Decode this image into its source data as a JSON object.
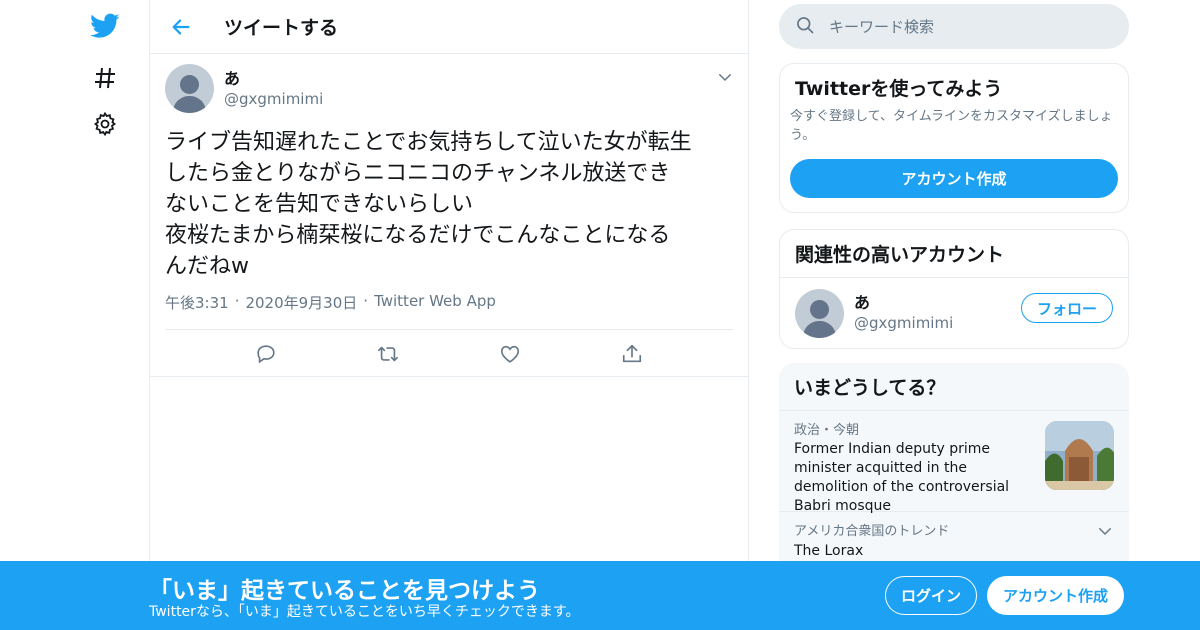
{
  "colors": {
    "accent": "#1da1f2",
    "text": "#14171a",
    "muted": "#657786",
    "border": "#e6ecf0"
  },
  "leftnav": {
    "icons": [
      "twitter-logo-icon",
      "hashtag-icon",
      "gear-icon"
    ]
  },
  "header": {
    "title": "ツイートする"
  },
  "tweet": {
    "author_name": "あ",
    "author_handle": "@gxgmimimi",
    "text": "ライブ告知遅れたことでお気持ちして泣いた女が転生\nしたら金とりながらニコニコのチャンネル放送でき\nないことを告知できないらしい\n夜桜たまから楠栞桜になるだけでこんなことになる\nんだねw",
    "time": "午後3:31",
    "date": "2020年9月30日",
    "source": "Twitter Web App",
    "separator": "·"
  },
  "search": {
    "placeholder": "キーワード検索"
  },
  "signup_card": {
    "title": "Twitterを使ってみよう",
    "description": "今すぐ登録して、タイムラインをカスタマイズしましょう。",
    "button": "アカウント作成"
  },
  "relevant_card": {
    "title": "関連性の高いアカウント",
    "account_name": "あ",
    "account_handle": "@gxgmimimi",
    "follow_button": "フォロー"
  },
  "trends_card": {
    "title": "いまどうしてる？",
    "items": [
      {
        "context": "政治・今朝",
        "headline": "Former Indian deputy prime minister acquitted in the demolition of the controversial Babri mosque"
      },
      {
        "context": "アメリカ合衆国のトレンド",
        "name": "The Lorax"
      }
    ]
  },
  "bottom_bar": {
    "title": "「いま」起きていることを見つけよう",
    "subtitle": "Twitterなら、「いま」起きていることをいち早くチェックできます。",
    "login": "ログイン",
    "signup": "アカウント作成"
  }
}
